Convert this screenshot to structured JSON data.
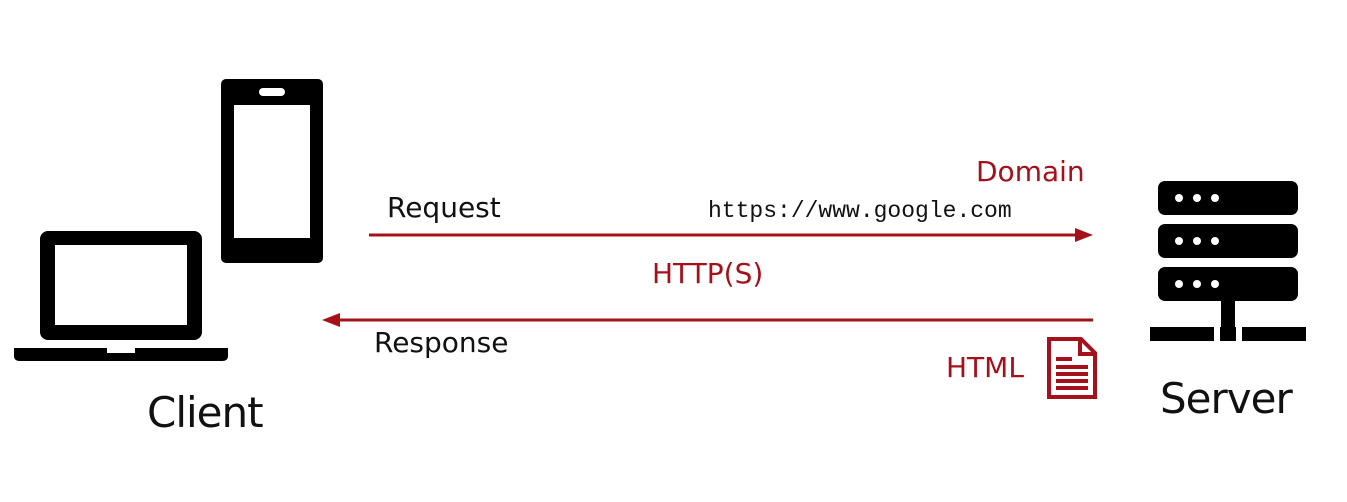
{
  "colors": {
    "accent": "#a5101b",
    "dark": "#111111",
    "background": "#ffffff"
  },
  "client": {
    "label": "Client",
    "icons": [
      "smartphone-icon",
      "laptop-icon"
    ]
  },
  "server": {
    "label": "Server",
    "icons": [
      "server-rack-icon"
    ]
  },
  "request": {
    "label": "Request",
    "domain_label": "Domain",
    "url": "https://www.google.com"
  },
  "protocol": {
    "label": "HTTP(S)"
  },
  "response": {
    "label": "Response",
    "payload_label": "HTML",
    "payload_icon": "document-icon"
  }
}
